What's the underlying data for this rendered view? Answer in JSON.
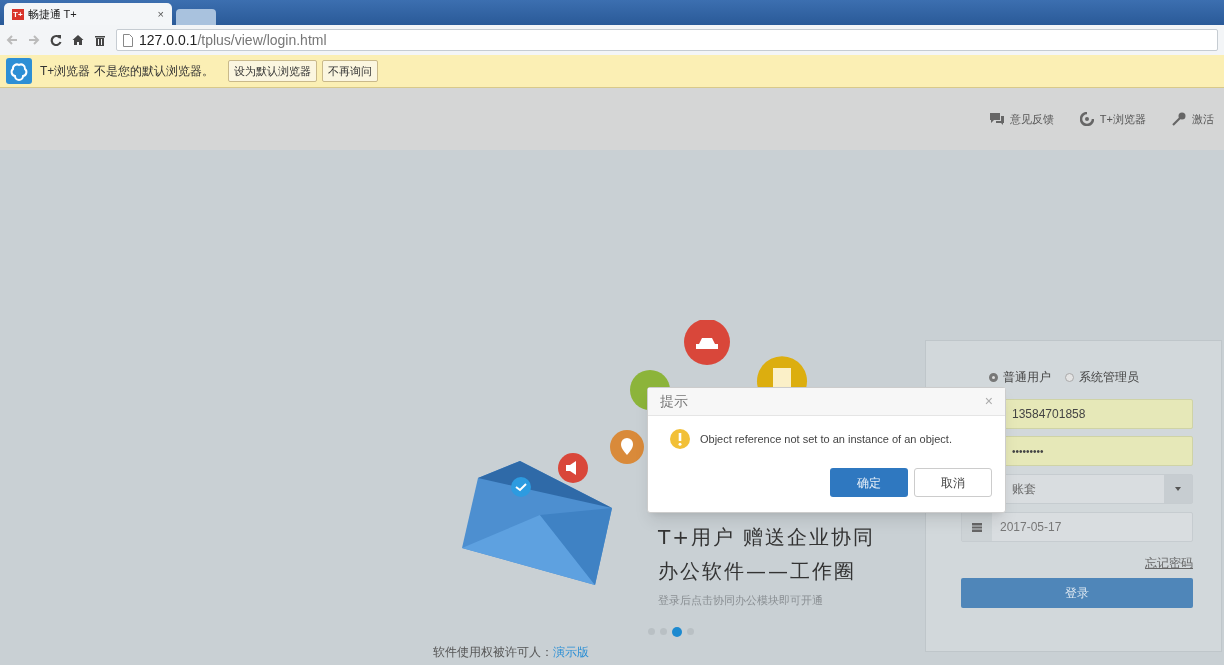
{
  "browser": {
    "tab": {
      "favicon": "T+",
      "title": "畅捷通 T+",
      "close": "×"
    },
    "address": {
      "host": "127.0.0.1",
      "path": "/tplus/view/login.html"
    }
  },
  "infobar": {
    "message": "T+浏览器 不是您的默认浏览器。",
    "buttons": [
      "设为默认浏览器",
      "不再询问"
    ]
  },
  "header_links": [
    {
      "kind": "feedback",
      "label": "意见反馈"
    },
    {
      "kind": "browser",
      "label": "T+浏览器"
    },
    {
      "kind": "activate",
      "label": "激活"
    }
  ],
  "promo": {
    "headline": "T+用户 赠送企业协同",
    "title": "办公软件——工作圈",
    "subtitle": "登录后点击协同办公模块即可开通",
    "dots": [
      {
        "selected": false
      },
      {
        "selected": false
      },
      {
        "selected": true
      },
      {
        "selected": false
      }
    ]
  },
  "footer": {
    "label": "软件使用权被许可人：",
    "link": "演示版"
  },
  "login": {
    "roles": [
      {
        "label": "普通用户",
        "selected": true
      },
      {
        "label": "系统管理员",
        "selected": false
      }
    ],
    "username": "13584701858",
    "password": "•••••••••",
    "account": "账套",
    "date": "2017-05-17",
    "forgot": "忘记密码",
    "submit": "登录"
  },
  "dialog": {
    "title": "提示",
    "close": "×",
    "message": "Object reference not set to an instance of an object.",
    "buttons": [
      {
        "label": "确定",
        "primary": true
      },
      {
        "label": "取消",
        "primary": false
      }
    ]
  }
}
